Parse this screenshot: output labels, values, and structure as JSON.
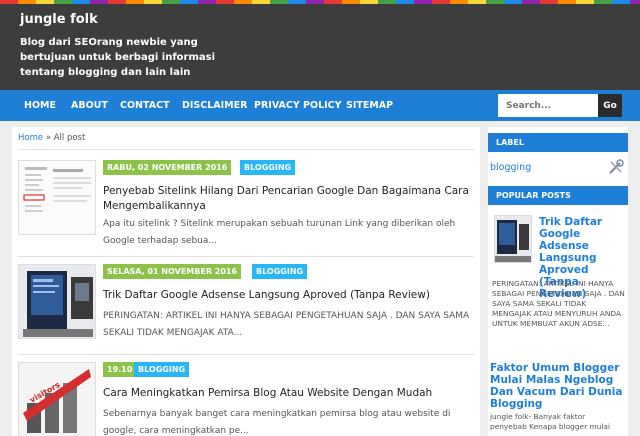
{
  "header": {
    "title": "jungle folk",
    "description": "Blog dari SEOrang newbie yang bertujuan untuk berbagi informasi tentang blogging dan lain lain"
  },
  "nav": {
    "items": [
      "HOME",
      "ABOUT",
      "CONTACT",
      "DISCLAIMER",
      "PRIVACY POLICY",
      "SITEMAP"
    ]
  },
  "search": {
    "placeholder": "Search...",
    "button": "Go"
  },
  "breadcrumb": {
    "home": "Home",
    "separator": "»",
    "current": "All post"
  },
  "posts": [
    {
      "date": "RABU, 02 NOVEMBER 2016",
      "label": "BLOGGING",
      "title": "Penyebab Sitelink Hilang Dari Pencarian Google Dan Bagaimana Cara Mengembalikannya",
      "snippet": "Apa itu sitelink ?  Sitelink merupakan sebuah turunan Link yang diberikan oleh Google terhadap sebua..."
    },
    {
      "date": "SELASA, 01 NOVEMBER 2016",
      "label": "BLOGGING",
      "title": "Trik Daftar Google Adsense Langsung Aproved (Tanpa Review)",
      "snippet": "   PERINGATAN:  ARTIKEL INI HANYA SEBAGAI  PENGETAHUAN SAJA .  DAN SAYA SAMA SEKALI TIDAK MENGAJAK ATA..."
    },
    {
      "date": "19.10",
      "label": "BLOGGING",
      "title": "Cara Meningkatkan Pemirsa Blog Atau Website Dengan Mudah",
      "snippet": "Sebenarnya banyak banget cara meningkatkan pemirsa blog atau website di google, cara meningkatkan pe..."
    }
  ],
  "sidebar": {
    "label_heading": "LABEL",
    "label_item": "blogging",
    "popular_heading": "POPULAR POSTS",
    "popular": [
      {
        "title": "Trik Daftar Google Adsense Langsung Aproved (Tanpa Review)",
        "snippet": "   PERINGATAN: ARTIKEL INI HANYA SEBAGAI  PENGETAHUAN SAJA .  DAN SAYA SAMA SEKALI TIDAK MENGAJAK ATAU MENYURUH ANDA UNTUK MEMBUAT  AKUN ADSE..."
      },
      {
        "title": "Faktor Umum Blogger Mulai Malas Ngeblog Dan Vacum Dari Dunia Blogging",
        "snippet": "jungle folk-  Banyak  faktor penyebab Kenapa blogger mulai"
      }
    ]
  },
  "thumb3_text": "visitors",
  "colors": {
    "header_bg": "#3d3d3d",
    "nav_bg": "#1e7fd6",
    "date_badge": "#8bc34a",
    "label_badge": "#29b6f6",
    "link": "#1e7fd6",
    "page_bg": "#ededed"
  }
}
